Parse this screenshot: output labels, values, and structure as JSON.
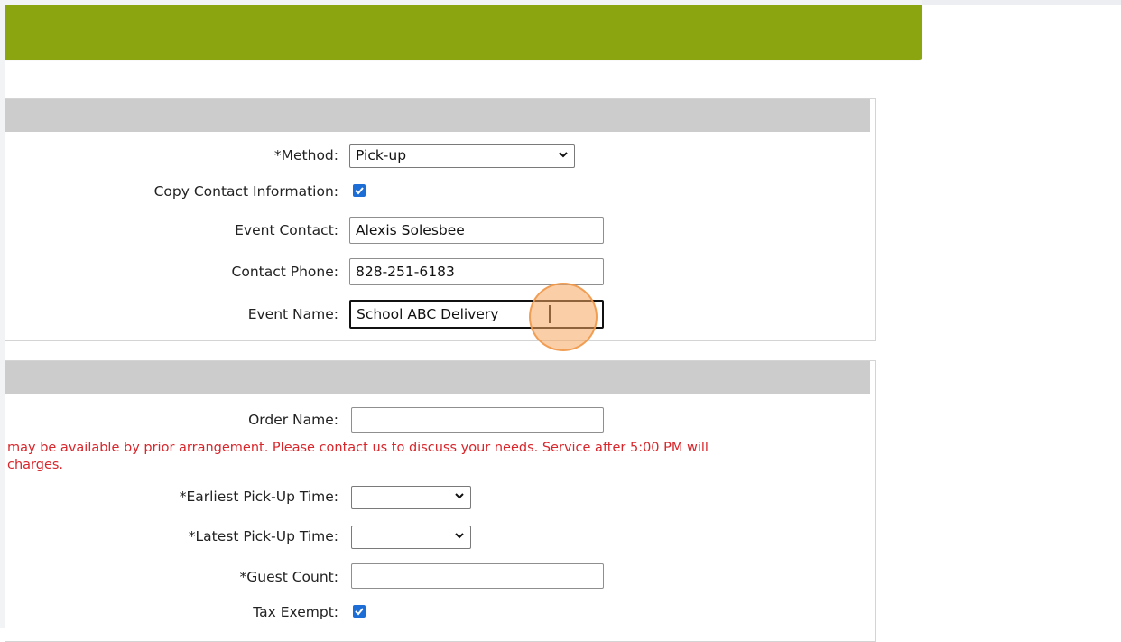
{
  "banner": {
    "color": "#8aa50f"
  },
  "event_section": {
    "method": {
      "label": "*Method:",
      "value": "Pick-up"
    },
    "copy_contact": {
      "label": "Copy Contact Information:",
      "checked": true
    },
    "event_contact": {
      "label": "Event Contact:",
      "value": "Alexis Solesbee"
    },
    "contact_phone": {
      "label": "Contact Phone:",
      "value": "828-251-6183"
    },
    "event_name": {
      "label": "Event Name:",
      "value": "School ABC Delivery"
    }
  },
  "order_section": {
    "order_name": {
      "label": "Order Name:",
      "value": ""
    },
    "notice_line1": "may be available by prior arrangement. Please contact us to discuss your needs. Service after 5:00 PM will",
    "notice_line2": "charges.",
    "earliest_pickup": {
      "label": "*Earliest Pick-Up Time:",
      "value": ""
    },
    "latest_pickup": {
      "label": "*Latest Pick-Up Time:",
      "value": ""
    },
    "guest_count": {
      "label": "*Guest Count:",
      "value": ""
    },
    "tax_exempt": {
      "label": "Tax Exempt:",
      "checked": true
    }
  },
  "colors": {
    "accent_green": "#8aa50f",
    "checkbox_blue": "#1d6dd6",
    "notice_red": "#d8262b",
    "section_header_gray": "#cccccc"
  }
}
